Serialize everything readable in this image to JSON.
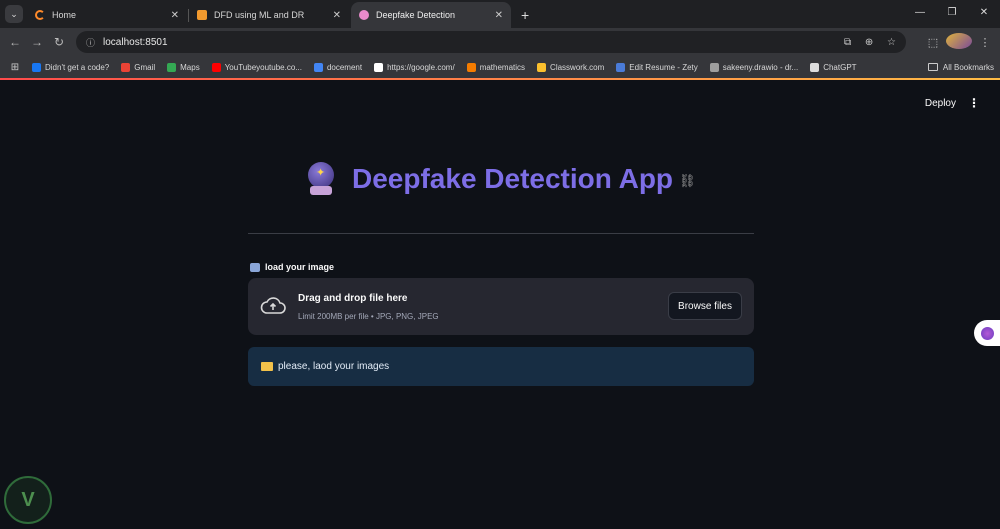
{
  "browser": {
    "tabs": [
      {
        "title": "Home",
        "active": false
      },
      {
        "title": "DFD using ML and DR",
        "active": false
      },
      {
        "title": "Deepfake Detection",
        "active": true
      }
    ],
    "new_tab_symbol": "+",
    "tab_close_symbol": "✕",
    "url": "localhost:8501",
    "bookmarks": [
      {
        "label": "Didn't get a code?",
        "icon_color": "#1877f2"
      },
      {
        "label": "Gmail",
        "icon_color": "#ea4335"
      },
      {
        "label": "Maps",
        "icon_color": "#34a853"
      },
      {
        "label": "YouTubeyoutube.co...",
        "icon_color": "#ff0000"
      },
      {
        "label": "docement",
        "icon_color": "#4285f4"
      },
      {
        "label": "https://google.com/",
        "icon_color": "#ffffff"
      },
      {
        "label": "mathematics",
        "icon_color": "#f57c00"
      },
      {
        "label": "Classwork.com",
        "icon_color": "#fbc02d"
      },
      {
        "label": "Edit Resume - Zety",
        "icon_color": "#4a7bd8"
      },
      {
        "label": "sakeeny.drawio - dr...",
        "icon_color": "#9e9e9e"
      },
      {
        "label": "ChatGPT",
        "icon_color": "#dddddd"
      }
    ],
    "all_bookmarks_label": "All Bookmarks"
  },
  "app": {
    "deploy_label": "Deploy",
    "title": "Deepfake Detection App",
    "title_color": "#7d6ee6",
    "uploader": {
      "label": "load your image",
      "drag_text": "Drag and drop file here",
      "limit_text": "Limit 200MB per file • JPG, PNG, JPEG",
      "browse_label": "Browse files"
    },
    "info_message": "please, laod your images"
  },
  "colors": {
    "background": "#0e1117",
    "dropzone": "#262730",
    "info_box": "#172d43"
  }
}
